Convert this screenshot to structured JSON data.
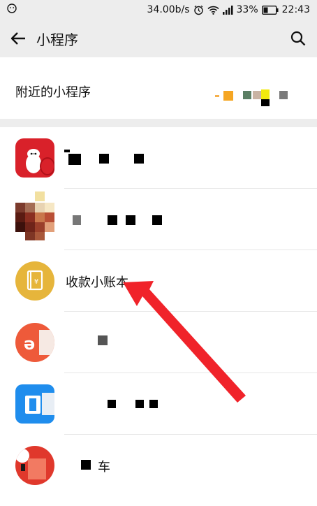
{
  "status_bar": {
    "network_speed": "34.00b/s",
    "battery": "33%",
    "time": "22:43",
    "icons": [
      "smiley-icon",
      "alarm-icon",
      "wifi-icon",
      "signal-icon",
      "battery-icon"
    ]
  },
  "nav": {
    "title": "小程序",
    "back_icon": "back-arrow-icon",
    "search_icon": "search-icon"
  },
  "nearby": {
    "label": "附近的小程序"
  },
  "apps": [
    {
      "name": "",
      "icon": "mascot-app-icon"
    },
    {
      "name": "",
      "icon": "mosaic-app-icon"
    },
    {
      "name": "收款小账本",
      "icon": "ledger-app-icon"
    },
    {
      "name": "",
      "icon": "orange-app-icon"
    },
    {
      "name": "",
      "icon": "blue-app-icon"
    },
    {
      "name": "车",
      "icon": "red-app-icon"
    }
  ],
  "annotation": {
    "color": "#f0232a",
    "points_to": "收款小账本"
  }
}
